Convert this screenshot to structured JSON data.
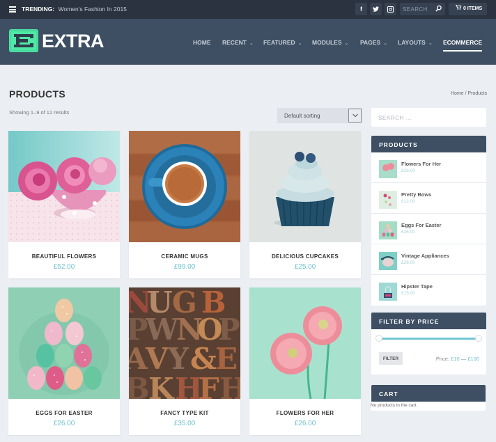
{
  "topbar": {
    "trending_label": "TRENDING:",
    "trending_text": "Women's Fashion In 2015",
    "social": [
      {
        "name": "facebook-icon",
        "glyph": "f"
      },
      {
        "name": "twitter-icon",
        "glyph": "t"
      },
      {
        "name": "instagram-icon",
        "glyph": "◙"
      }
    ],
    "search_placeholder": "SEARCH",
    "cart_label": "0 ITEMS"
  },
  "header": {
    "logo_text": "EXTRA",
    "logo_color": "#4fe8a6",
    "nav": [
      {
        "label": "HOME",
        "has_dropdown": false,
        "active": false
      },
      {
        "label": "RECENT",
        "has_dropdown": true,
        "active": false
      },
      {
        "label": "FEATURED",
        "has_dropdown": true,
        "active": false
      },
      {
        "label": "MODULES",
        "has_dropdown": true,
        "active": false
      },
      {
        "label": "PAGES",
        "has_dropdown": true,
        "active": false
      },
      {
        "label": "LAYOUTS",
        "has_dropdown": true,
        "active": false
      },
      {
        "label": "ECOMMERCE",
        "has_dropdown": false,
        "active": true
      }
    ],
    "chevron": "⌄"
  },
  "main": {
    "title": "PRODUCTS",
    "result_count": "Showing 1–9 of 12 results",
    "breadcrumb": "Home / Products",
    "sort_selected": "Default sorting",
    "price_color": "#6fc1cc",
    "products": [
      {
        "name": "BEAUTIFUL FLOWERS",
        "price": "£52.00",
        "image": "pink-roses"
      },
      {
        "name": "CERAMIC MUGS",
        "price": "£99.00",
        "image": "blue-coffee-cup"
      },
      {
        "name": "DELICIOUS CUPCAKES",
        "price": "£25.00",
        "image": "cupcake"
      },
      {
        "name": "EGGS FOR EASTER",
        "price": "£26.00",
        "image": "easter-eggs"
      },
      {
        "name": "FANCY TYPE KIT",
        "price": "£35.00",
        "image": "wood-type-letters"
      },
      {
        "name": "FLOWERS FOR HER",
        "price": "£26.00",
        "image": "pink-gerberas"
      }
    ]
  },
  "sidebar": {
    "search_placeholder": "SEARCH ...",
    "products_widget": {
      "title": "PRODUCTS",
      "items": [
        {
          "name": "Flowers For Her",
          "price": "£26.00"
        },
        {
          "name": "Pretty Bows",
          "price": "£12.00"
        },
        {
          "name": "Eggs For Easter",
          "price": "£26.00"
        },
        {
          "name": "Vintage Appliances",
          "price": "£26.00"
        },
        {
          "name": "Hipster Tape",
          "price": "£15.00"
        }
      ]
    },
    "filter_widget": {
      "title": "FILTER BY PRICE",
      "button_label": "FILTER",
      "price_label": "Price:",
      "min_price": "£10",
      "separator": "—",
      "max_price": "£100",
      "range_min_fraction": 0,
      "range_max_fraction": 1
    },
    "cart_widget": {
      "title": "CART",
      "empty_text": "No products in the cart."
    }
  }
}
